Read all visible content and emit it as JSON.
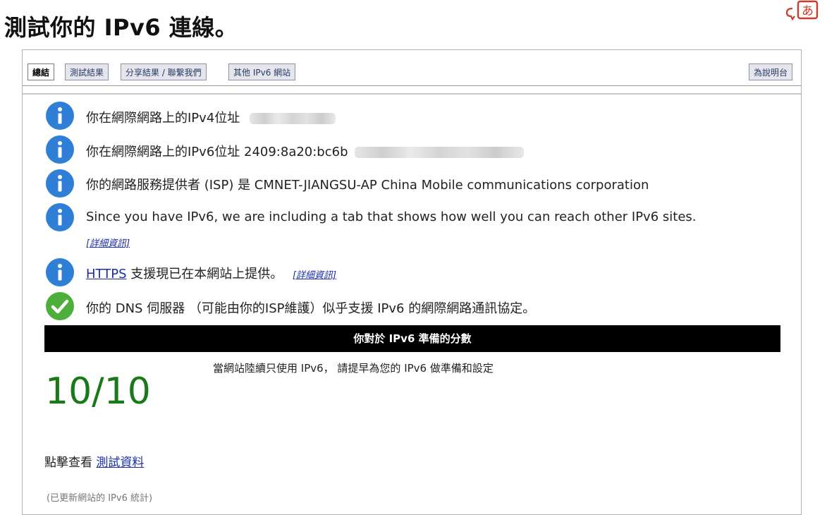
{
  "page": {
    "title": "測試你的 IPv6 連線。"
  },
  "translate_button": {
    "icon": "translate-icon"
  },
  "tabs": [
    {
      "label": "總結",
      "active": true
    },
    {
      "label": "測試結果",
      "active": false
    },
    {
      "label": "分享結果 / 聯繫我們",
      "active": false
    },
    {
      "label": "其他 IPv6 網站",
      "active": false
    }
  ],
  "help_tab": {
    "label": "為說明台"
  },
  "results": {
    "ipv4": {
      "label": "你在網際網路上的IPv4位址",
      "icon": "info-icon"
    },
    "ipv6": {
      "label": "你在網際網路上的IPv6位址 2409:8a20:bc6b",
      "icon": "info-icon"
    },
    "isp": {
      "label": "你的網路服務提供者 (ISP) 是 CMNET-JIANGSU-AP China Mobile communications corporation",
      "icon": "info-icon"
    },
    "ipv6_tab": {
      "label": "Since you have IPv6, we are including a tab that shows how well you can reach other IPv6 sites.",
      "more": "[詳細資訊]",
      "icon": "info-icon"
    },
    "https": {
      "link": "HTTPS",
      "label": " 支援現已在本網站上提供。",
      "more": "[詳細資訊]",
      "icon": "info-icon"
    },
    "dns": {
      "label": "你的 DNS 伺服器 （可能由你的ISP維護）似乎支援 IPv6 的網際網路通訊協定。",
      "icon": "check-icon"
    }
  },
  "score": {
    "banner": "你對於 IPv6 準備的分數",
    "subtitle": "當網站陸續只使用 IPv6， 請提早為您的 IPv6 做準備和設定",
    "value": "10/10"
  },
  "test_data": {
    "prefix": "點擊查看 ",
    "link": "測試資料"
  },
  "stats_note": "(已更新網站的 IPv6 統計)",
  "colors": {
    "info_blue": "#2f7fd6",
    "check_green": "#4caf3a",
    "score_green": "#1a7a1a",
    "link_blue": "#1a2ea8"
  }
}
